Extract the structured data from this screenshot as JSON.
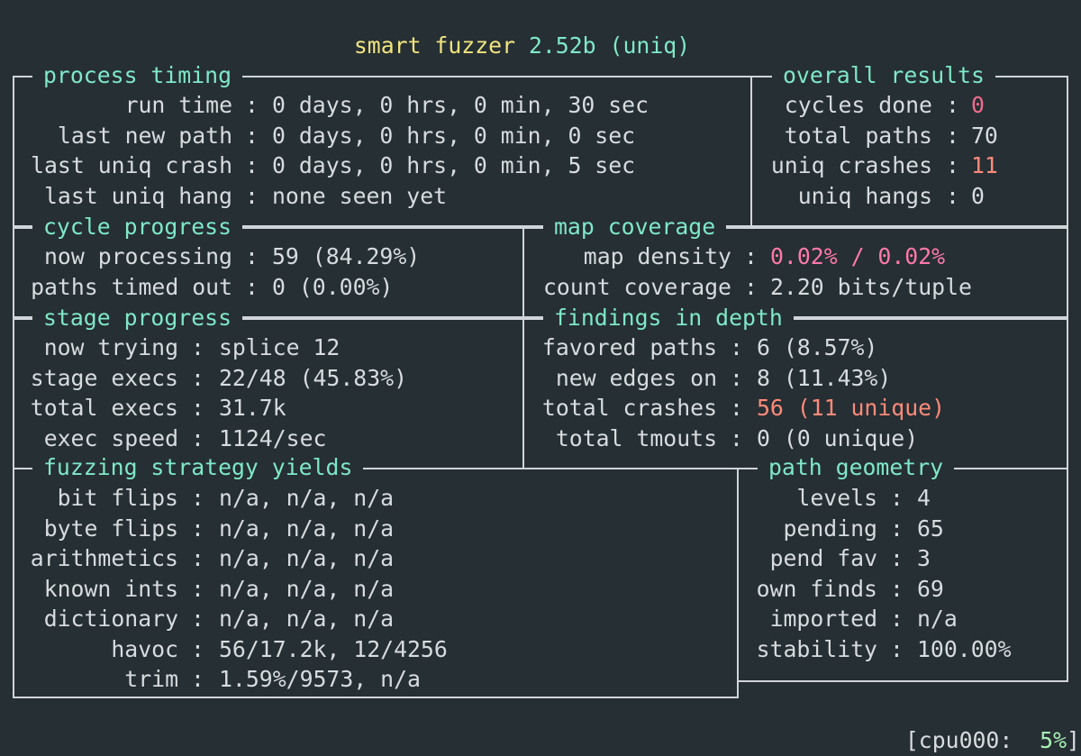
{
  "header": {
    "name": "smart fuzzer",
    "version": "2.52b",
    "mode": "(uniq)"
  },
  "process_timing": {
    "title": "process timing",
    "rows": [
      {
        "label": "run time",
        "value": "0 days, 0 hrs, 0 min, 30 sec"
      },
      {
        "label": "last new path",
        "value": "0 days, 0 hrs, 0 min, 0 sec"
      },
      {
        "label": "last uniq crash",
        "value": "0 days, 0 hrs, 0 min, 5 sec"
      },
      {
        "label": "last uniq hang",
        "value": "none seen yet"
      }
    ]
  },
  "overall_results": {
    "title": "overall results",
    "rows": [
      {
        "label": "cycles done",
        "value": "0"
      },
      {
        "label": "total paths",
        "value": "70"
      },
      {
        "label": "uniq crashes",
        "value": "11"
      },
      {
        "label": "uniq hangs",
        "value": "0"
      }
    ]
  },
  "cycle_progress": {
    "title": "cycle progress",
    "rows": [
      {
        "label": "now processing",
        "value": "59 (84.29%)"
      },
      {
        "label": "paths timed out",
        "value": "0 (0.00%)"
      }
    ]
  },
  "map_coverage": {
    "title": "map coverage",
    "rows": [
      {
        "label": "map density",
        "value": "0.02% / 0.02%"
      },
      {
        "label": "count coverage",
        "value": "2.20 bits/tuple"
      }
    ]
  },
  "stage_progress": {
    "title": "stage progress",
    "rows": [
      {
        "label": "now trying",
        "value": "splice 12"
      },
      {
        "label": "stage execs",
        "value": "22/48 (45.83%)"
      },
      {
        "label": "total execs",
        "value": "31.7k"
      },
      {
        "label": "exec speed",
        "value": "1124/sec"
      }
    ]
  },
  "findings_in_depth": {
    "title": "findings in depth",
    "rows": [
      {
        "label": "favored paths",
        "value": "6 (8.57%)"
      },
      {
        "label": "new edges on",
        "value": "8 (11.43%)"
      },
      {
        "label": "total crashes",
        "value": "56 (11 unique)"
      },
      {
        "label": "total tmouts",
        "value": "0 (0 unique)"
      }
    ]
  },
  "fuzzing_strategy_yields": {
    "title": "fuzzing strategy yields",
    "rows": [
      {
        "label": "bit flips",
        "value": "n/a, n/a, n/a"
      },
      {
        "label": "byte flips",
        "value": "n/a, n/a, n/a"
      },
      {
        "label": "arithmetics",
        "value": "n/a, n/a, n/a"
      },
      {
        "label": "known ints",
        "value": "n/a, n/a, n/a"
      },
      {
        "label": "dictionary",
        "value": "n/a, n/a, n/a"
      },
      {
        "label": "havoc",
        "value": "56/17.2k, 12/4256"
      },
      {
        "label": "trim",
        "value": "1.59%/9573, n/a"
      }
    ]
  },
  "path_geometry": {
    "title": "path geometry",
    "rows": [
      {
        "label": "levels",
        "value": "4"
      },
      {
        "label": "pending",
        "value": "65"
      },
      {
        "label": "pend fav",
        "value": "3"
      },
      {
        "label": "own finds",
        "value": "69"
      },
      {
        "label": "imported",
        "value": "n/a"
      },
      {
        "label": "stability",
        "value": "100.00%"
      }
    ]
  },
  "cpu": {
    "label": "[cpu000:",
    "value": "5%",
    "close": "]"
  },
  "colors": {
    "background": "#262f34",
    "title": "#7fe8c8",
    "header": "#f1e47e",
    "crash": "#ef6a8c",
    "density": "#ff79a8",
    "total_crashes": "#ff8a7a",
    "cpu": "#a8f0b4"
  }
}
